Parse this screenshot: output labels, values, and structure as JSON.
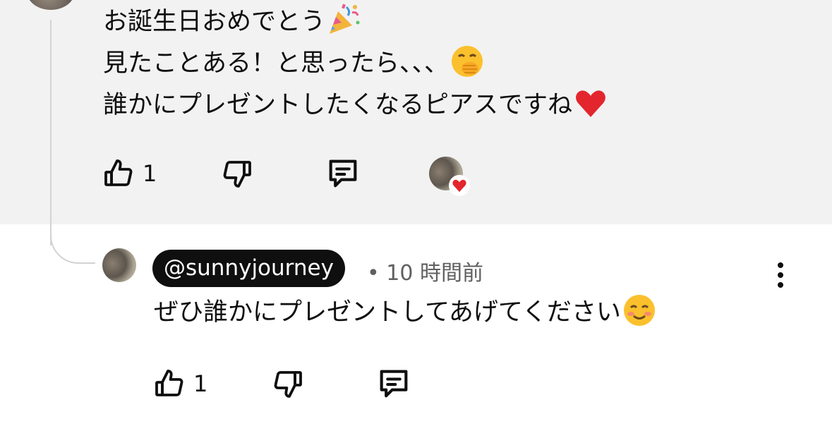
{
  "parent_comment": {
    "lines": [
      "お誕生日おめでとう",
      "見たことある！と思ったら、、、",
      "誰かにプレゼントしたくなるピアスですね"
    ],
    "line_emojis": [
      "party-popper-emoji",
      "hand-over-mouth-emoji",
      "red-heart-emoji"
    ],
    "like_count": "1"
  },
  "reply": {
    "handle": "@sunnyjourney",
    "separator": "•",
    "time": "10 時間前",
    "text": "ぜひ誰かにプレゼントしてあげてください",
    "emoji": "smiling-face-emoji",
    "like_count": "1"
  },
  "colors": {
    "parent_background": "#f2f2f2",
    "badge_background": "#0f0f0f",
    "meta_text": "#606060",
    "heart": "#e3262d"
  }
}
